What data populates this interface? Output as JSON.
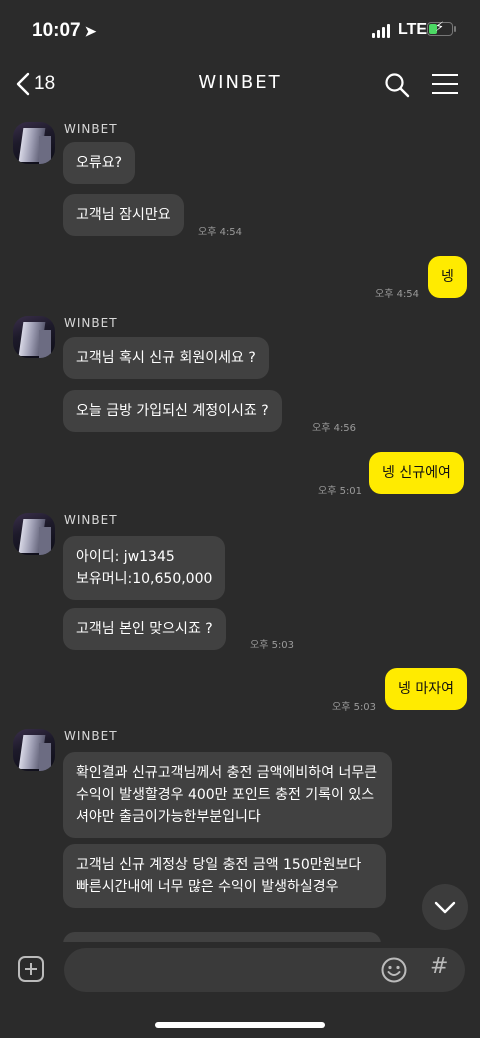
{
  "status_bar": {
    "time": "10:07",
    "network": "LTE"
  },
  "header": {
    "back_count": "18",
    "title": "WINBET"
  },
  "messages": {
    "g1": {
      "sender": "WINBET",
      "m1": "오류요?",
      "m2": "고객님 잠시만요",
      "time": "오후 4:54"
    },
    "o1": {
      "text": "넹",
      "time": "오후 4:54"
    },
    "g2": {
      "sender": "WINBET",
      "m1": "고객님 혹시  신규 회원이세요 ?",
      "m2": "오늘 금방 가입되신 계정이시죠 ?",
      "time": "오후 4:56"
    },
    "o2": {
      "text": "넹 신규에여",
      "time": "오후 5:01"
    },
    "g3": {
      "sender": "WINBET",
      "m1_line1": "아이디:  jw1345",
      "m1_line2": "보유머니:10,650,000",
      "m2": "고객님 본인 맞으시죠 ?",
      "time": "오후 5:03"
    },
    "o3": {
      "text": "넹 마자여",
      "time": "오후 5:03"
    },
    "g4": {
      "sender": "WINBET",
      "m1": "확인결과 신규고객님께서 충전 금액에비하여 너무큰수익이 발생할경우 400만 포인트 충전 기록이 있스셔야만 출금이가능한부분입니다",
      "m2": "고객님 신규 계정상 당일 충전 금액 150만원보다 빠른시간내에 너무 많은 수익이 발생하실경우"
    }
  },
  "input": {
    "placeholder": ""
  },
  "icons": {
    "back": "chevron-left-icon",
    "search": "search-icon",
    "menu": "hamburger-menu-icon",
    "add": "plus-icon",
    "emoji": "emoji-icon",
    "hash": "hash-icon",
    "scroll": "chevron-down-icon"
  },
  "colors": {
    "background": "#2b2b2b",
    "bubble_incoming": "#414141",
    "bubble_outgoing": "#ffeb00",
    "battery": "#4cd964"
  }
}
